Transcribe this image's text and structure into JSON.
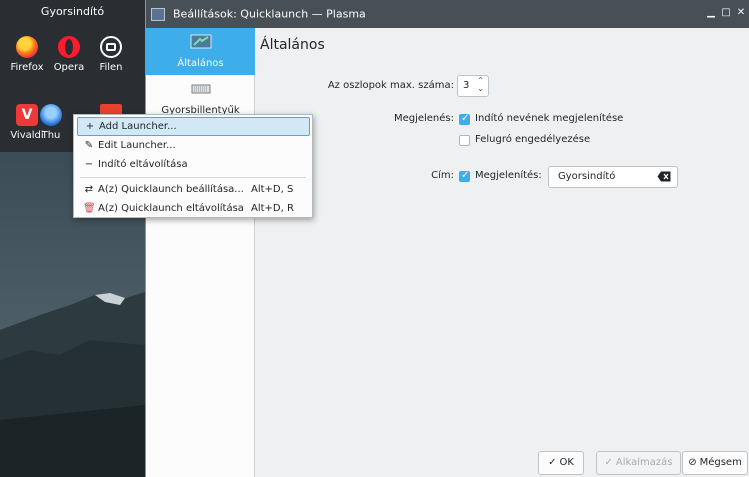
{
  "panel": {
    "title": "Gyorsindító",
    "launchers": [
      {
        "label": "Firefox",
        "icon": "firefox-icon"
      },
      {
        "label": "Opera",
        "icon": "opera-icon"
      },
      {
        "label": "Filen",
        "icon": "filen-icon"
      },
      {
        "label": "Vivaldi",
        "icon": "vivaldi-icon"
      },
      {
        "label": "Thu",
        "icon": "thunderbird-icon"
      },
      {
        "label": "",
        "icon": "app-icon"
      }
    ]
  },
  "window": {
    "title": "Beállítások: Quicklaunch — Plasma",
    "controls": {
      "minimize": "▁",
      "maximize": "□",
      "close": "✕"
    }
  },
  "sidebar": {
    "items": [
      {
        "label": "Általános",
        "icon": "general-settings-icon",
        "active": true
      },
      {
        "label": "Gyorsbillentyűk",
        "icon": "keyboard-icon",
        "active": false
      }
    ]
  },
  "content": {
    "title": "Általános",
    "max_columns_label": "Az oszlopok max. száma:",
    "max_columns_value": "3",
    "appearance_label": "Megjelenés:",
    "show_launcher_names": "Indító nevének megjelenítése",
    "show_launcher_names_checked": true,
    "enable_popup": "Felugró engedélyezése",
    "enable_popup_checked": false,
    "title_label": "Cím:",
    "title_show": "Megjelenítés:",
    "title_show_checked": true,
    "title_value": "Gyorsindító"
  },
  "buttons": {
    "ok": "OK",
    "apply": "Alkalmazás",
    "cancel": "Mégsem"
  },
  "context_menu": {
    "items": [
      {
        "label": "Add Launcher...",
        "icon": "+",
        "shortcut": "",
        "highlighted": true
      },
      {
        "label": "Edit Launcher...",
        "icon": "✎",
        "shortcut": "",
        "highlighted": false
      },
      {
        "label": "Indító eltávolítása",
        "icon": "−",
        "shortcut": "",
        "highlighted": false
      },
      {
        "label": "A(z) Quicklaunch beállítása...",
        "icon": "⇄",
        "shortcut": "Alt+D, S",
        "highlighted": false
      },
      {
        "label": "A(z) Quicklaunch eltávolítása",
        "icon": "🗑",
        "shortcut": "Alt+D, R",
        "highlighted": false
      }
    ]
  },
  "colors": {
    "accent": "#3daee9",
    "panel_bg": "#2a2e32",
    "titlebar_bg": "#475057",
    "window_bg": "#eff0f1"
  }
}
